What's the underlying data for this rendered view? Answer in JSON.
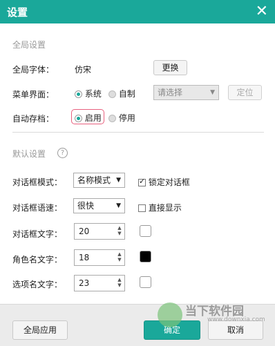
{
  "titlebar": {
    "title": "设置",
    "close_icon": "close-icon"
  },
  "global": {
    "section_title": "全局设置",
    "font_label": "全局字体：",
    "font_value": "仿宋",
    "font_change_button": "更换",
    "menu_label": "菜单界面：",
    "menu_option_system": "系统",
    "menu_option_custom": "自制",
    "menu_selected": "系统",
    "menu_select_placeholder": "请选择",
    "menu_locate_button": "定位",
    "autosave_label": "自动存档：",
    "autosave_on": "启用",
    "autosave_off": "停用",
    "autosave_selected": "启用"
  },
  "defaults": {
    "section_title": "默认设置",
    "help_icon": "?",
    "dialog_mode_label": "对话框模式：",
    "dialog_mode_value": "名称模式",
    "lock_dialog_label": "锁定对话框",
    "lock_dialog_checked": true,
    "dialog_speed_label": "对话框语速：",
    "dialog_speed_value": "很快",
    "direct_show_label": "直接显示",
    "direct_show_checked": false,
    "dialog_text_label": "对话框文字：",
    "dialog_text_size": "20",
    "dialog_text_color": "#ffffff",
    "role_name_label": "角色名文字：",
    "role_name_size": "18",
    "role_name_color": "#000000",
    "option_name_label": "选项名文字：",
    "option_name_size": "23",
    "option_name_color": "#ffffff"
  },
  "footer": {
    "apply_global_button": "全局应用",
    "ok_button": "确定",
    "cancel_button": "取消"
  },
  "watermark": {
    "text": "当下软件园",
    "url": "www.downxia.com"
  },
  "colors": {
    "accent": "#1aa89a",
    "highlight": "#e8607e"
  }
}
